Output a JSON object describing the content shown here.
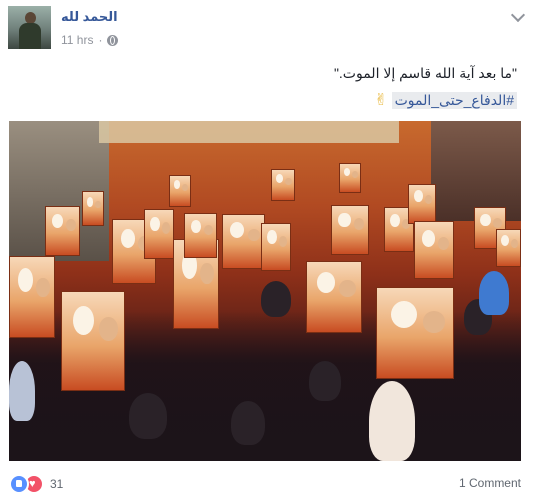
{
  "post": {
    "page_name": "الحمد لله",
    "timestamp": "11 hrs",
    "privacy_icon": "globe-icon",
    "text": "\"ما بعد آية الله قاسم إلا الموت.\"",
    "hashtag": "#الدفاع_حتى_الموت",
    "emoji_icon": "victory-hand-icon"
  },
  "footer": {
    "reaction_icons": [
      "like-icon",
      "love-icon"
    ],
    "reaction_count": "31",
    "comments_label": "1 Comment"
  },
  "colors": {
    "link": "#365899",
    "meta": "#90949c",
    "like": "#5890ff",
    "love": "#f25268"
  }
}
